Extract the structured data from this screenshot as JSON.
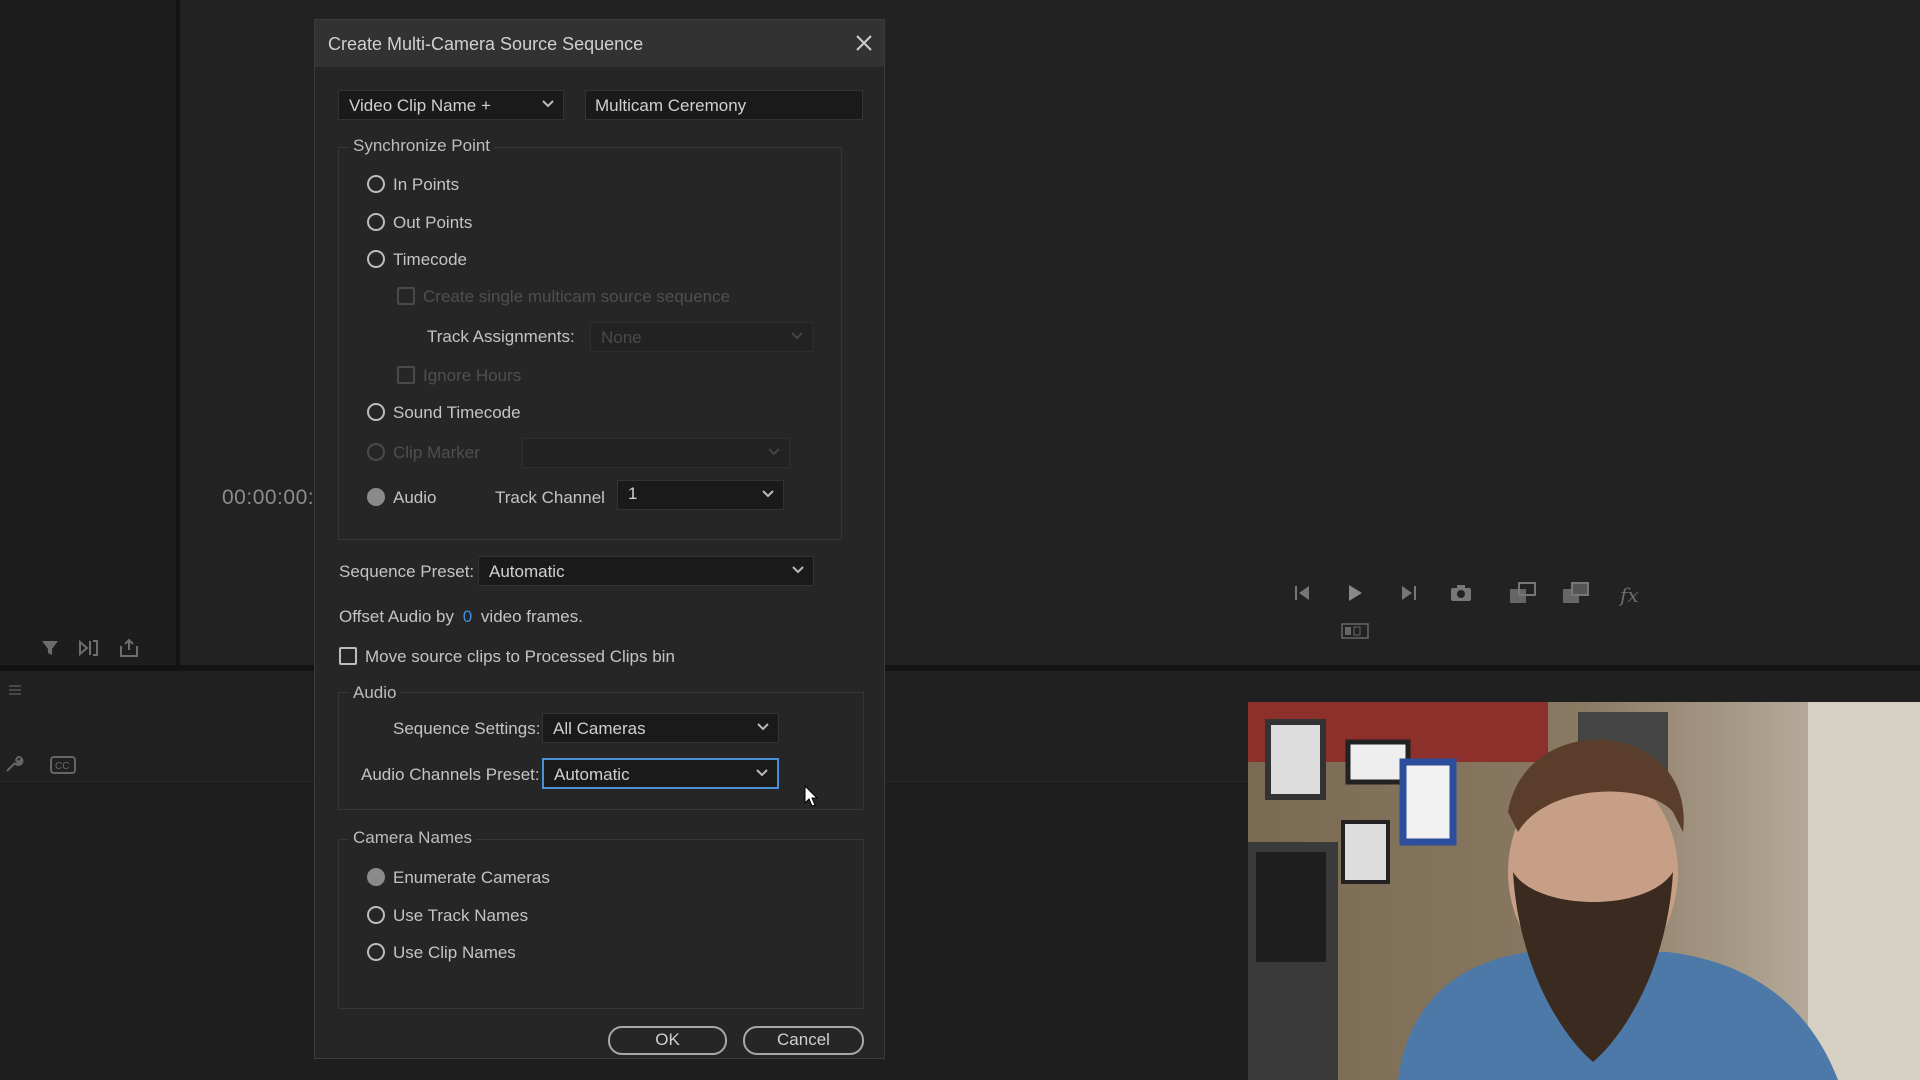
{
  "background": {
    "timecode": "00:00:00:",
    "program_controls": [
      "step-back-icon",
      "play-icon",
      "step-forward-icon",
      "camera-icon",
      "insert-icon",
      "overwrite-icon",
      "fx-icon"
    ]
  },
  "dialog": {
    "title": "Create Multi-Camera Source Sequence",
    "name_mode": "Video Clip Name +",
    "name_value": "Multicam Ceremony",
    "sync": {
      "legend": "Synchronize Point",
      "in_points": "In Points",
      "out_points": "Out Points",
      "timecode": "Timecode",
      "create_single": "Create single multicam source sequence",
      "track_assignments_label": "Track Assignments:",
      "track_assignments_value": "None",
      "ignore_hours": "Ignore Hours",
      "sound_timecode": "Sound Timecode",
      "clip_marker": "Clip Marker",
      "audio": "Audio",
      "track_channel_label": "Track Channel",
      "track_channel_value": "1",
      "selected": "Audio"
    },
    "sequence_preset_label": "Sequence Preset:",
    "sequence_preset_value": "Automatic",
    "offset_prefix": "Offset Audio by",
    "offset_value": "0",
    "offset_suffix": "video frames.",
    "move_clips": "Move source clips to Processed Clips bin",
    "audio": {
      "legend": "Audio",
      "sequence_settings_label": "Sequence Settings:",
      "sequence_settings_value": "All Cameras",
      "channels_preset_label": "Audio Channels Preset:",
      "channels_preset_value": "Automatic"
    },
    "camera_names": {
      "legend": "Camera Names",
      "enumerate": "Enumerate Cameras",
      "track_names": "Use Track Names",
      "clip_names": "Use Clip Names",
      "selected": "Enumerate Cameras"
    },
    "ok": "OK",
    "cancel": "Cancel"
  },
  "colors": {
    "accent_blue": "#3f8fe0",
    "dialog_bg": "#262626"
  }
}
